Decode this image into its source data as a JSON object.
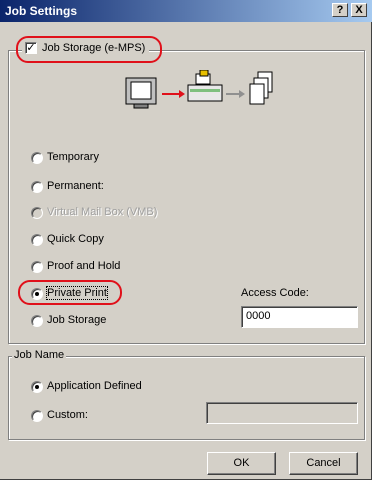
{
  "window": {
    "title": "Job Settings",
    "help_label": "?",
    "close_label": "X"
  },
  "job_storage_group": {
    "checkbox_label": "Job Storage (e-MPS)",
    "checked": true,
    "options": [
      {
        "label": "Temporary",
        "selected": false,
        "enabled": true
      },
      {
        "label": "Permanent:",
        "selected": false,
        "enabled": true
      },
      {
        "label": "Virtual Mail Box (VMB)",
        "selected": false,
        "enabled": false
      },
      {
        "label": "Quick Copy",
        "selected": false,
        "enabled": true
      },
      {
        "label": "Proof and Hold",
        "selected": false,
        "enabled": true
      },
      {
        "label": "Private Print",
        "selected": true,
        "enabled": true
      },
      {
        "label": "Job Storage",
        "selected": false,
        "enabled": true
      }
    ],
    "access_code_label": "Access Code:",
    "access_code_value": "0000"
  },
  "job_name_group": {
    "label": "Job Name",
    "options": [
      {
        "label": "Application Defined",
        "selected": true
      },
      {
        "label": "Custom:",
        "selected": false
      }
    ],
    "custom_value": ""
  },
  "buttons": {
    "ok": "OK",
    "cancel": "Cancel"
  },
  "colors": {
    "highlight": "#e0101a",
    "title_bar": "#0a246a",
    "dialog_face": "#d4d0c8"
  }
}
